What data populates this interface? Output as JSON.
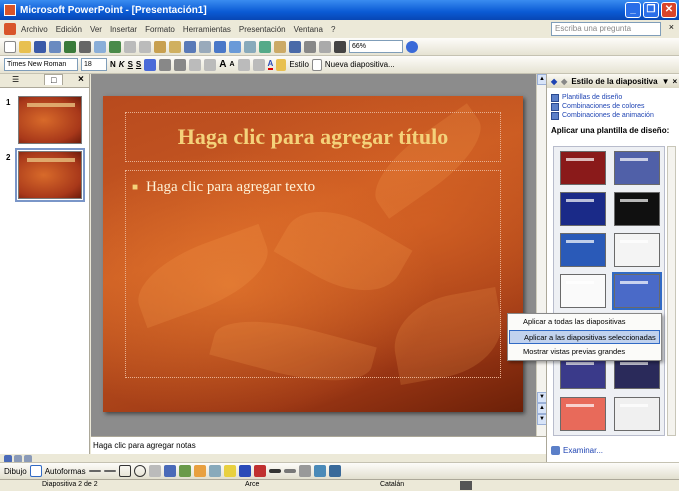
{
  "window": {
    "title": "Microsoft PowerPoint - [Presentación1]",
    "minimize": "_",
    "restore": "❐",
    "close": "✕"
  },
  "menubar": {
    "items": [
      "Archivo",
      "Edición",
      "Ver",
      "Insertar",
      "Formato",
      "Herramientas",
      "Presentación",
      "Ventana",
      "?"
    ],
    "ask_placeholder": "Escriba una pregunta",
    "close_doc": "×"
  },
  "standard_toolbar": {
    "zoom": "66%"
  },
  "format_toolbar": {
    "font": "Times New Roman",
    "size": "18",
    "bold": "N",
    "italic": "K",
    "underline": "S",
    "shadow": "S",
    "grow_font": "A",
    "shrink_font": "A",
    "font_color": "A",
    "design_label": "Estilo",
    "new_slide_label": "Nueva diapositiva..."
  },
  "left_panel": {
    "tab_outline": "☰",
    "tab_slides": "□",
    "close": "×",
    "slides": [
      {
        "number": "1"
      },
      {
        "number": "2"
      }
    ]
  },
  "slide": {
    "title_placeholder": "Haga clic para agregar título",
    "body_placeholder": "Haga clic para agregar texto"
  },
  "notes": {
    "placeholder": "Haga clic para agregar notas"
  },
  "task_pane": {
    "title": "Estilo de la diapositiva",
    "links": [
      "Plantillas de diseño",
      "Combinaciones de colores",
      "Combinaciones de animación"
    ],
    "apply_heading": "Aplicar una plantilla de diseño:",
    "browse": "Examinar..."
  },
  "context_menu": {
    "items": [
      "Aplicar a todas las diapositivas",
      "Aplicar a las diapositivas seleccionadas",
      "Mostrar vistas previas grandes"
    ]
  },
  "draw_toolbar": {
    "draw": "Dibujo",
    "autoshapes": "Autoformas"
  },
  "status": {
    "slide_info": "Diapositiva 2 de 2",
    "design": "Arce",
    "language": "Catalán"
  },
  "colors": {
    "titlebar": "#0a5ad4",
    "slide_bg": "#b84a1e",
    "title_text": "#f4d27a",
    "link": "#1f44b3",
    "highlight": "#c1d2ee"
  }
}
